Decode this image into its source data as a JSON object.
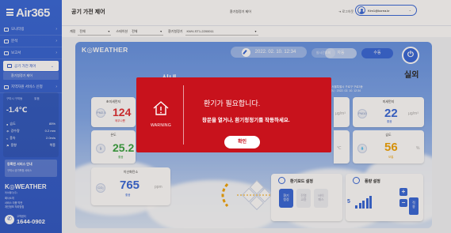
{
  "app": {
    "logo": "Air365",
    "page_title": "공기 가전 제어",
    "center_title": "환기청정기 제어",
    "logout": "로그아웃",
    "user": "Kim1@korea.kr"
  },
  "sidebar": {
    "items": [
      {
        "label": "모니터링"
      },
      {
        "label": "분석"
      },
      {
        "label": "보고서"
      },
      {
        "label": "공기 가전 제어"
      },
      {
        "label": "지역자원 서비스 신청"
      }
    ],
    "sub_item": "환기청정기 제어",
    "weather": {
      "header": "구미시 구미동",
      "header_right": "맑음",
      "temp": "-1.4℃",
      "rows": [
        {
          "k": "습도",
          "v": "85%"
        },
        {
          "k": "강수량",
          "v": "0.2 mm"
        },
        {
          "k": "풍속",
          "v": "2.0m/s"
        },
        {
          "k": "풍향",
          "v": "북풍"
        }
      ]
    },
    "service": {
      "title": "등록된 서비스 안내",
      "sub": "구미시 공기측정 서비스"
    },
    "brand": "K◎WEATHER",
    "brand_sub": "케이웨더(주)",
    "footer": [
      "회사소개",
      "서비스 이용 약관",
      "개인정보 처리방침"
    ],
    "phone_label": "고객센터",
    "phone": "1644-0902"
  },
  "filters": {
    "f1_label": "계정",
    "f1_value": "전체",
    "f2_label": "스테이션",
    "f2_value": "전체",
    "f3_label": "환기청정기",
    "f3_value": "KWV-ST1-2200011"
  },
  "stage": {
    "brand": "K◎WEATHER",
    "date": "2022. 02. 10. 12:34",
    "btn_ghost": "실시간조회",
    "btn_auto": "자동",
    "btn_manual": "수동",
    "power": "⏻",
    "indoor_title": "실내",
    "outdoor_title": "실외",
    "location": "위치 : 서울특별시 구로구 구로3동",
    "measured": "측정일시 : 2022. 02. 10. 12:34"
  },
  "indoor": {
    "fine_dust": {
      "label": "초미세먼지",
      "value": "124",
      "status": "매우나쁨",
      "icon": "PM2.5"
    },
    "temp": {
      "label": "온도",
      "value": "25.2",
      "status": "좋음"
    },
    "co2": {
      "label": "이산화탄소",
      "value": "765",
      "unit": "ppm",
      "status": "좋음",
      "icon": "CO₂"
    }
  },
  "outdoor": {
    "pm25_unit": "μg/m³",
    "pm10": {
      "label": "미세먼지",
      "value": "22",
      "unit": "μg/m³",
      "status": "좋음",
      "icon": "PM10"
    },
    "temp_unit": "℃",
    "hum": {
      "label": "습도",
      "value": "56",
      "unit": "%",
      "status": "보통"
    }
  },
  "vent": {
    "title": "환기모드 설정",
    "modes": [
      "환기\n청정",
      "전열\n교환",
      "바이\n패스"
    ]
  },
  "fan": {
    "title": "풍량 설정",
    "value": "5",
    "plus": "+",
    "minus": "−",
    "save": "적\n용"
  },
  "alert": {
    "title": "환기가 필요합니다.",
    "message": "창문을 열거나, 환기청정기를 작동하세요.",
    "warning": "WARNING",
    "confirm": "확인"
  },
  "colors": {
    "primary": "#2f62d8",
    "alert": "#c8121c",
    "bad": "#e0262c",
    "good": "#2f62d8",
    "moderate": "#f1a100"
  }
}
